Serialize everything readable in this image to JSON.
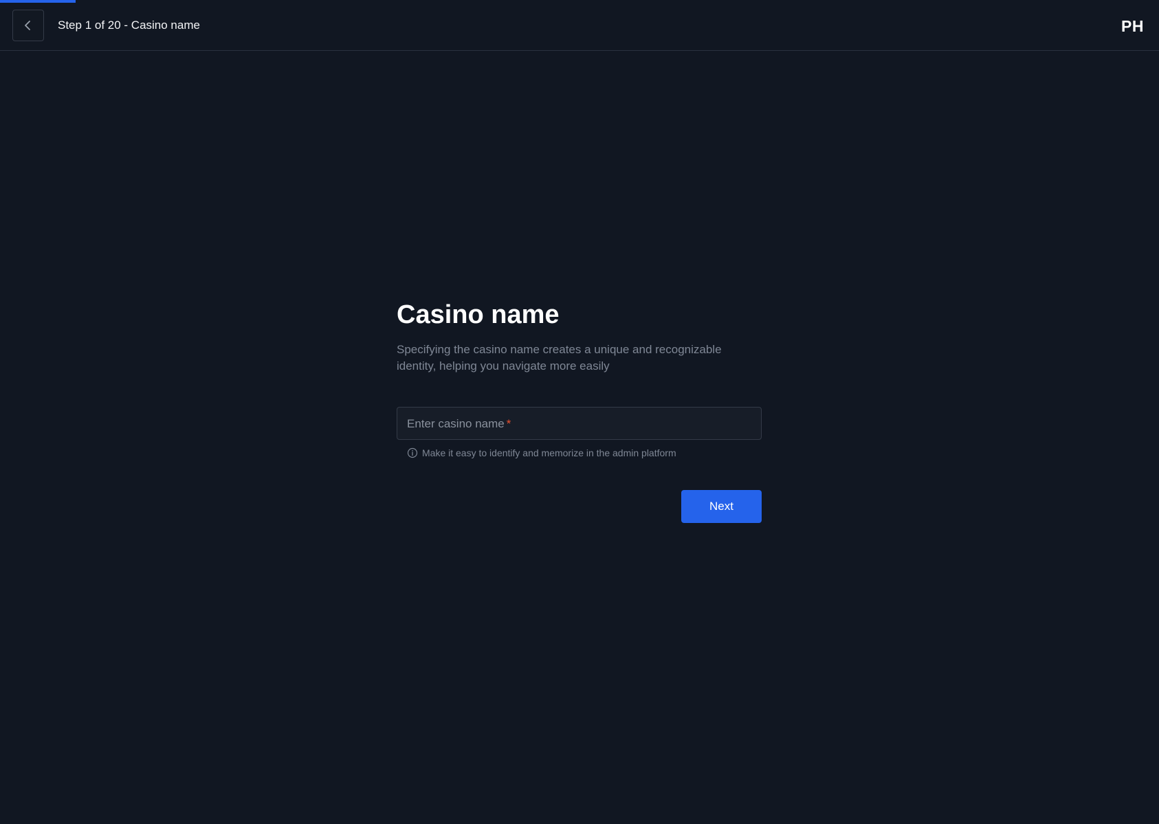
{
  "progress": {
    "current_step": 1,
    "total_steps": 20,
    "fraction": 0.05,
    "color": "#2563eb"
  },
  "header": {
    "back_icon": "chevron-left-icon",
    "step_title": "Step 1 of 20 - Casino name",
    "avatar_initials": "PH"
  },
  "main": {
    "title": "Casino name",
    "description": "Specifying the casino name creates a unique and recognizable identity, helping you navigate more easily",
    "field": {
      "label": "Enter casino name",
      "required_mark": "*",
      "value": ""
    },
    "hint": {
      "icon": "info-circle-icon",
      "text": "Make it easy to identify and memorize in the admin platform"
    },
    "next_button_label": "Next"
  },
  "colors": {
    "background": "#111722",
    "accent": "#2563eb",
    "required": "#e8502f"
  }
}
